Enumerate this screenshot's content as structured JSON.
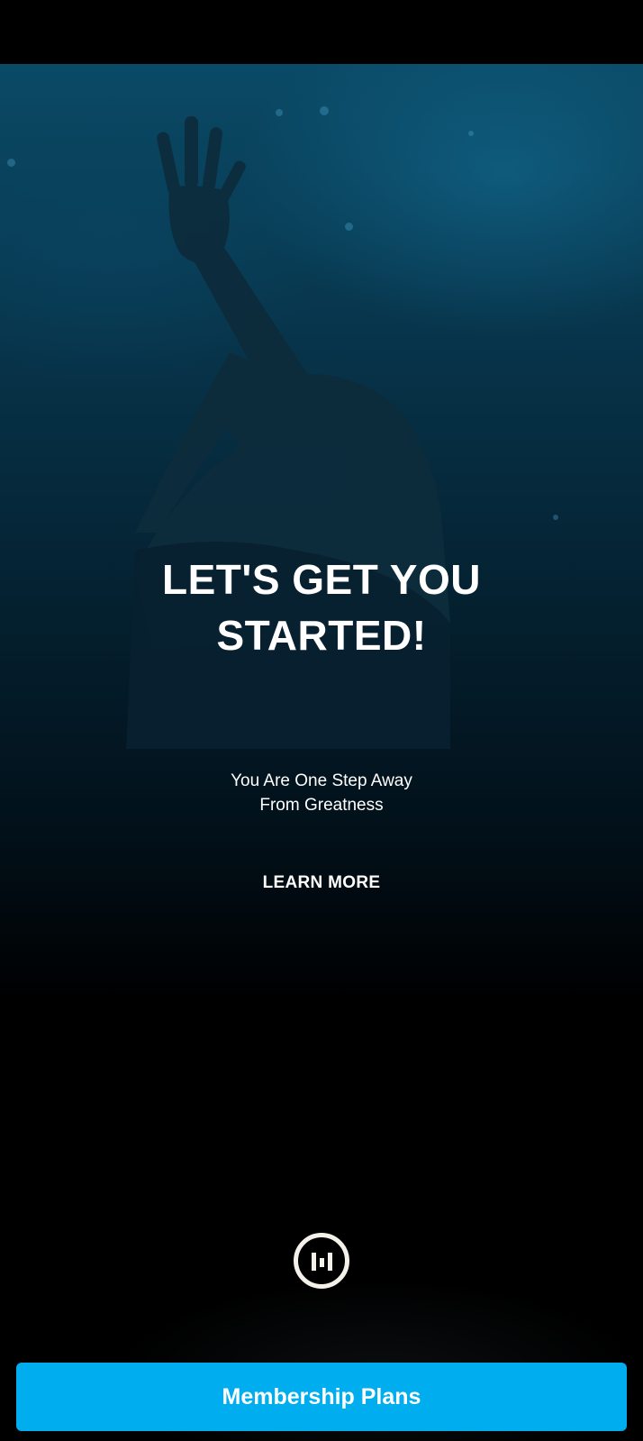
{
  "hero": {
    "headline_line1": "LET'S GET YOU",
    "headline_line2": "STARTED!",
    "subtitle_line1": "You Are One Step Away",
    "subtitle_line2": "From Greatness",
    "learn_more_label": "LEARN MORE",
    "background_image": "person-raising-hand-in-blue-haze"
  },
  "brand": {
    "logo_icon": "brand-logo-icon"
  },
  "cta": {
    "label": "Membership Plans"
  },
  "colors": {
    "accent": "#00aeef",
    "background": "#000000",
    "hero_tint": "#0a4a66",
    "text": "#ffffff",
    "logo": "#f3f1ea"
  }
}
